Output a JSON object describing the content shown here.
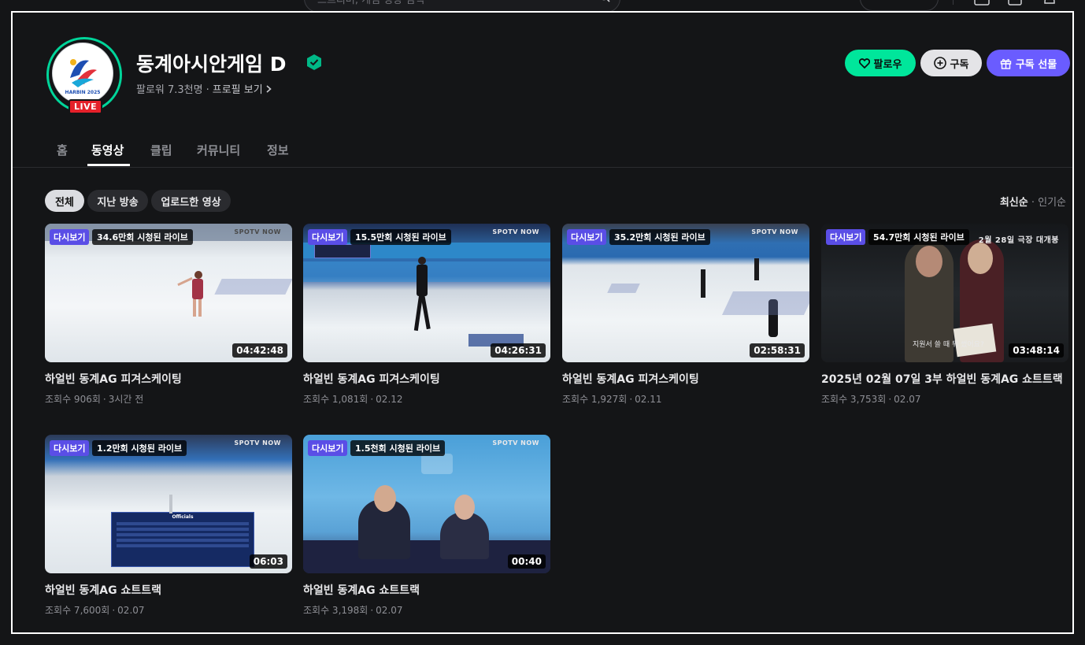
{
  "top": {
    "search_placeholder": "스트리머, 게임 영상 검색"
  },
  "channel": {
    "name": "동계아시안게임 D",
    "followers": "팔로워 7.3천명",
    "profile_link": "프로필 보기",
    "live_badge": "LIVE"
  },
  "actions": {
    "follow": "팔로우",
    "subscribe": "구독",
    "gift": "구독 선물"
  },
  "tabs": [
    "홈",
    "동영상",
    "클립",
    "커뮤니티",
    "정보"
  ],
  "filters": [
    "전체",
    "지난 방송",
    "업로드한 영상"
  ],
  "sort": {
    "latest": "최신순",
    "popular": "인기순"
  },
  "colors": {
    "accent_green": "#00e69b",
    "accent_purple": "#6a5cff",
    "live_red": "#e5202a"
  },
  "videos": [
    {
      "badge": "다시보기",
      "views_badge": "34.6만회 시청된 라이브",
      "duration": "04:42:48",
      "title": "하얼빈 동계AG 피겨스케이팅",
      "views": "조회수 906회",
      "date": "3시간 전",
      "watermark": "SPOTV NOW"
    },
    {
      "badge": "다시보기",
      "views_badge": "15.5만회 시청된 라이브",
      "duration": "04:26:31",
      "title": "하얼빈 동계AG 피겨스케이팅",
      "views": "조회수 1,081회",
      "date": "02.12",
      "watermark": "SPOTV NOW"
    },
    {
      "badge": "다시보기",
      "views_badge": "35.2만회 시청된 라이브",
      "duration": "02:58:31",
      "title": "하얼빈 동계AG 피겨스케이팅",
      "views": "조회수 1,927회",
      "date": "02.11",
      "watermark": "SPOTV NOW"
    },
    {
      "badge": "다시보기",
      "views_badge": "54.7만회 시청된 라이브",
      "duration": "03:48:14",
      "title": "2025년 02월 07일 3부 하얼빈 동계AG 쇼트트랙",
      "views": "조회수 3,753회",
      "date": "02.07",
      "watermark": "2월 28일 극장 대개봉",
      "subtitle": "지원서 쓸 때 뭐 썼어요?"
    },
    {
      "badge": "다시보기",
      "views_badge": "1.2만회 시청된 라이브",
      "duration": "06:03",
      "title": "하얼빈 동계AG 쇼트트랙",
      "views": "조회수 7,600회",
      "date": "02.07",
      "watermark": "SPOTV NOW",
      "officials_title": "Officials"
    },
    {
      "badge": "다시보기",
      "views_badge": "1.5천회 시청된 라이브",
      "duration": "00:40",
      "title": "하얼빈 동계AG 쇼트트랙",
      "views": "조회수 3,198회",
      "date": "02.07",
      "watermark": "SPOTV NOW"
    }
  ]
}
